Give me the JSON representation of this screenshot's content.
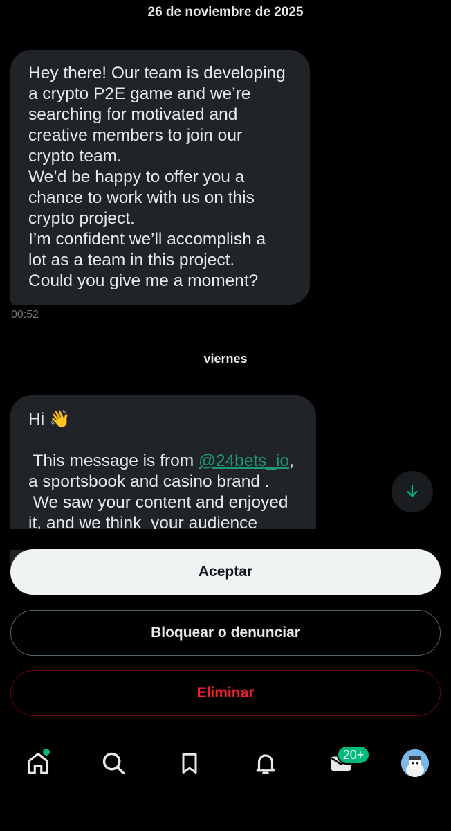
{
  "conversation": {
    "date_top": "26 de noviembre de 2025",
    "message1": {
      "lines": [
        "Hey there! Our team is developing",
        "a crypto P2E game and we’re",
        "searching for motivated and",
        "creative members to join our",
        "crypto team.",
        "We’d be happy to offer you a",
        "chance to work with us on this",
        "crypto project.",
        "I’m confident we’ll accomplish a",
        "lot as a team in this project.",
        "Could you give me a moment?"
      ],
      "time": "00:52"
    },
    "date_mid": "viernes",
    "message2": {
      "greeting": "Hi 👋",
      "line1_prefix": " This message is from ",
      "line1_link": "@24bets_io",
      "line1_suffix": ",",
      "line2": "a sportsbook and casino brand .",
      "line3": " We saw your content and enjoyed",
      "line4": "it, and we think  your audience"
    }
  },
  "actions": {
    "accept": "Aceptar",
    "block_report": "Bloquear o denunciar",
    "delete": "Eliminar"
  },
  "nav": {
    "items": [
      "home-icon",
      "search-icon",
      "bookmark-icon",
      "bell-icon",
      "mail-icon",
      "avatar"
    ],
    "messages_badge": "20+"
  },
  "colors": {
    "background": "#000000",
    "bubble": "#202327",
    "accent_green": "#00ba7c",
    "link_green": "#1d9b70",
    "danger_red": "#f4212e"
  }
}
